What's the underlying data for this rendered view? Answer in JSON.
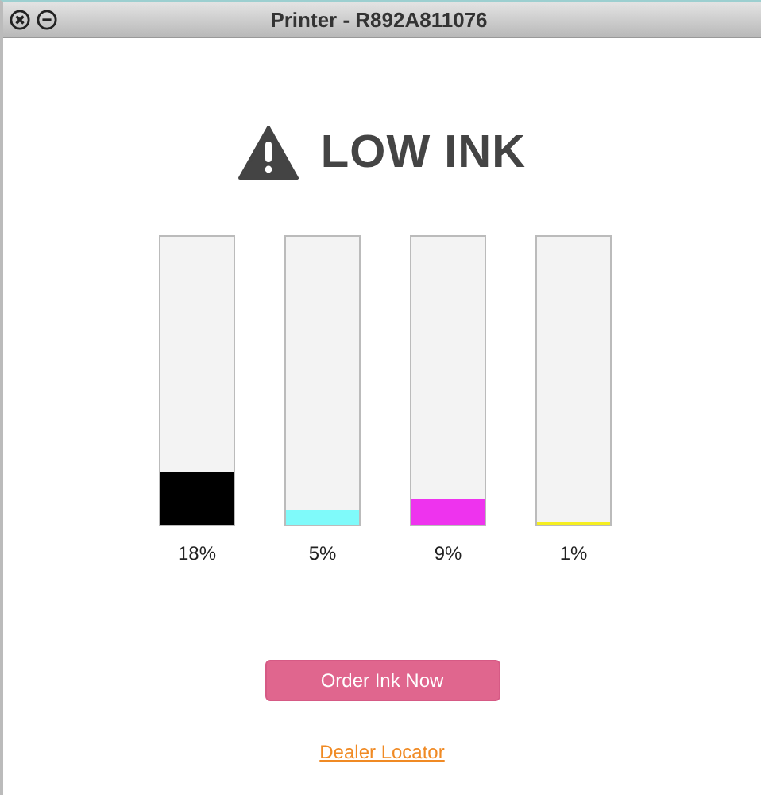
{
  "window": {
    "title": "Printer - R892A811076"
  },
  "alert": {
    "heading": "LOW INK"
  },
  "cartridges": [
    {
      "color": "#000000",
      "level": 0.18,
      "reading": "18%"
    },
    {
      "color": "#7ffafa",
      "level": 0.05,
      "reading": "5%"
    },
    {
      "color": "#ee33ee",
      "level": 0.09,
      "reading": "9%"
    },
    {
      "color": "#f5ee20",
      "level": 0.01,
      "reading": "1%"
    }
  ],
  "order_button": {
    "label": "Order Ink Now"
  },
  "dealer_link": {
    "label": "Dealer Locator"
  }
}
